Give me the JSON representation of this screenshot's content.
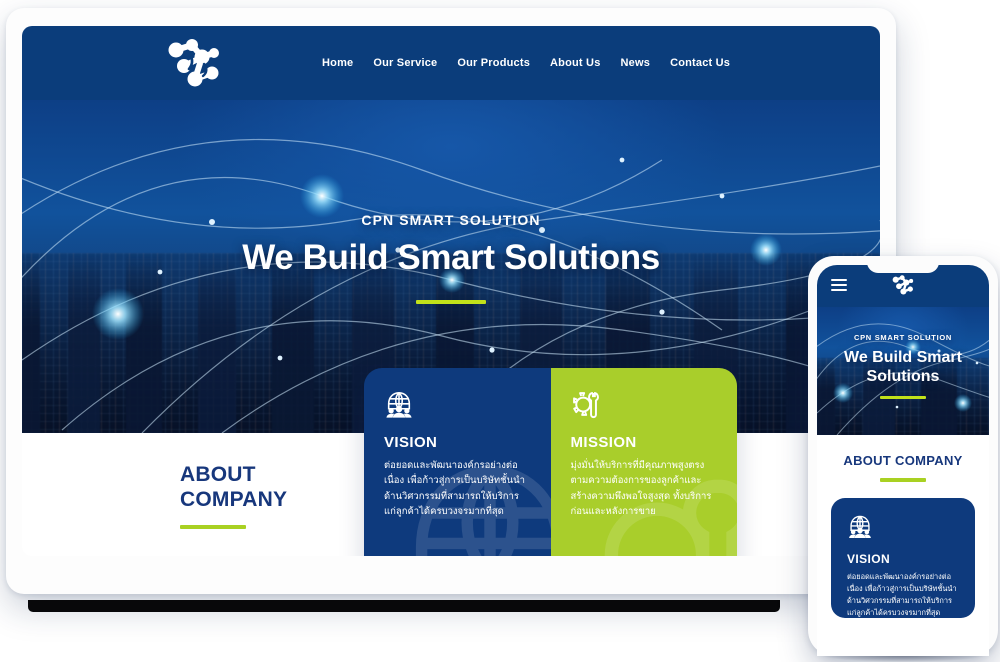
{
  "brand": {
    "logo_icon": "molecule-network-logo",
    "navy": "#0b3d7b",
    "lime": "#a9ce2b",
    "accent_rule": "#c2e21a"
  },
  "nav": {
    "items": [
      {
        "label": "Home"
      },
      {
        "label": "Our Service"
      },
      {
        "label": "Our Products"
      },
      {
        "label": "About Us"
      },
      {
        "label": "News"
      },
      {
        "label": "Contact Us"
      }
    ]
  },
  "hero": {
    "kicker": "CPN SMART SOLUTION",
    "title": "We Build Smart Solutions"
  },
  "about": {
    "title_line1": "ABOUT",
    "title_line2": "COMPANY",
    "title_mobile": "ABOUT COMPANY"
  },
  "cards": {
    "vision": {
      "icon": "globe-people-icon",
      "title": "VISION",
      "body": "ต่อยอดและพัฒนาองค์กรอย่างต่อเนื่อง เพื่อก้าวสู่การเป็นบริษัทชั้นนำด้านวิศวกรรมที่สามารถให้บริการแก่ลูกค้าได้ครบวงจรมากที่สุด"
    },
    "mission": {
      "icon": "gear-wrench-icon",
      "title": "MISSION",
      "body": "มุ่งมั่นให้บริการที่มีคุณภาพสูงตรงตามความต้องการของลูกค้าและสร้างความพึงพอใจสูงสุด ทั้งบริการก่อนและหลังการขาย"
    }
  },
  "phone": {
    "menu_icon": "hamburger-menu-icon",
    "logo_icon": "molecule-network-logo"
  }
}
